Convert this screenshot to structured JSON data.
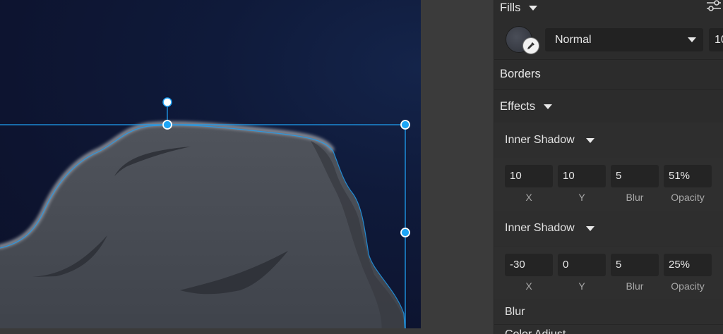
{
  "inspector": {
    "fills": {
      "title": "Fills",
      "blend_mode": "Normal",
      "opacity_partial": "10"
    },
    "borders": {
      "title": "Borders"
    },
    "effects": {
      "title": "Effects",
      "inner_shadows": [
        {
          "title": "Inner Shadow",
          "x": "10",
          "y": "10",
          "blur": "5",
          "opacity": "51%",
          "labels": {
            "x": "X",
            "y": "Y",
            "blur": "Blur",
            "opacity": "Opacity"
          }
        },
        {
          "title": "Inner Shadow",
          "x": "-30",
          "y": "0",
          "blur": "5",
          "opacity": "25%",
          "labels": {
            "x": "X",
            "y": "Y",
            "blur": "Blur",
            "opacity": "Opacity"
          }
        }
      ],
      "blur": {
        "title": "Blur"
      },
      "next_partial": "Color Adjust"
    }
  },
  "colors": {
    "canvas_bg": "#0d1430",
    "rock_fill": "#4b4f57",
    "selection": "#1e9ff2",
    "panel_bg": "#2c2c2c",
    "field_bg": "#242424"
  },
  "icons": {
    "settings": "sliders-icon",
    "eyedropper": "eyedropper-icon"
  }
}
